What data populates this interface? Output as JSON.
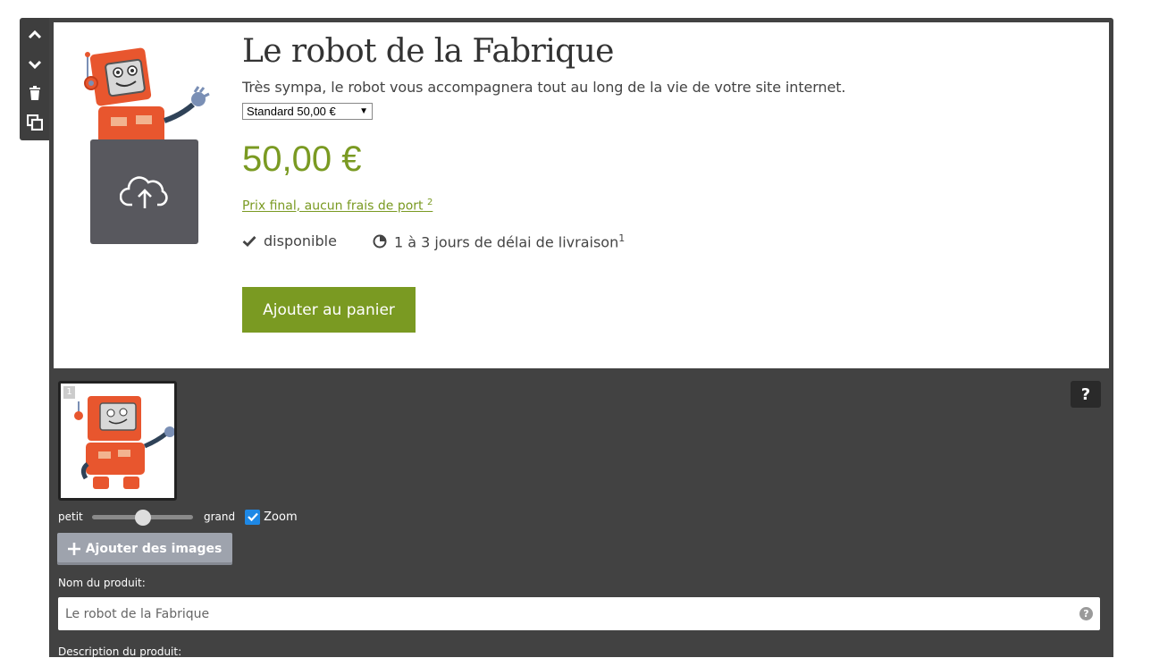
{
  "product": {
    "title": "Le robot de la Fabrique",
    "description": "Très sympa, le robot vous accompagnera tout au long de la vie de votre site internet.",
    "variant_selected": "Standard 50,00 €",
    "price": "50,00 €",
    "price_note": "Prix final, aucun frais de port",
    "price_note_footnote": "2",
    "availability": "disponible",
    "delivery": "1 à 3 jours de délai de livraison",
    "delivery_footnote": "1",
    "add_to_cart_label": "Ajouter au panier"
  },
  "editor": {
    "help_label": "?",
    "thumbnail_index": "1",
    "size_small_label": "petit",
    "size_large_label": "grand",
    "size_level": 0.5,
    "zoom_label": "Zoom",
    "zoom_checked": true,
    "add_images_label": "Ajouter des images",
    "product_name_label": "Nom du produit:",
    "product_name_value": "Le robot de la Fabrique",
    "product_description_label": "Description du produit:"
  },
  "toolbar_icons": [
    "chevron-up-icon",
    "chevron-down-icon",
    "trash-icon",
    "duplicate-icon"
  ],
  "colors": {
    "accent_green": "#7a9a22",
    "editor_bg": "#424242",
    "zoom_checkbox": "#1e88e5",
    "robot_orange": "#e8562e"
  }
}
